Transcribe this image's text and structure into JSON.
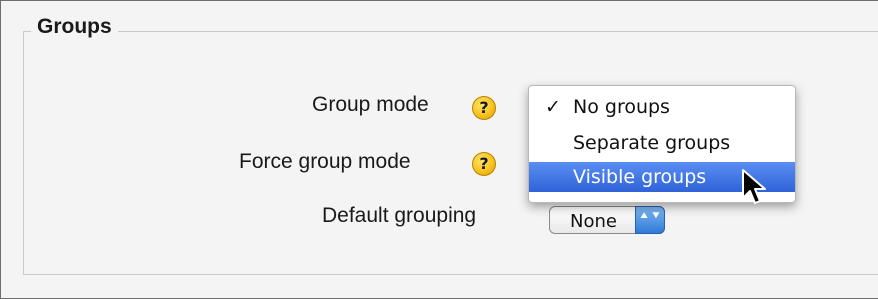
{
  "fieldset": {
    "legend": "Groups"
  },
  "rows": {
    "group_mode": {
      "label": "Group mode",
      "help_icon": "help-icon",
      "help_glyph": "?"
    },
    "force_group_mode": {
      "label": "Force group mode",
      "help_icon": "help-icon",
      "help_glyph": "?"
    },
    "default_grouping": {
      "label": "Default grouping",
      "selected_value": "None"
    }
  },
  "group_mode_menu": {
    "items": [
      {
        "label": "No groups",
        "check": "✓",
        "checked": true,
        "highlighted": false
      },
      {
        "label": "Separate groups",
        "check": "",
        "checked": false,
        "highlighted": false
      },
      {
        "label": "Visible groups",
        "check": "",
        "checked": false,
        "highlighted": true
      }
    ]
  },
  "select_arrows_glyph": "▲▼",
  "colors": {
    "highlight": "#3a6fe0",
    "help_icon": "#f7c320",
    "select_accent": "#2f7bd8"
  }
}
